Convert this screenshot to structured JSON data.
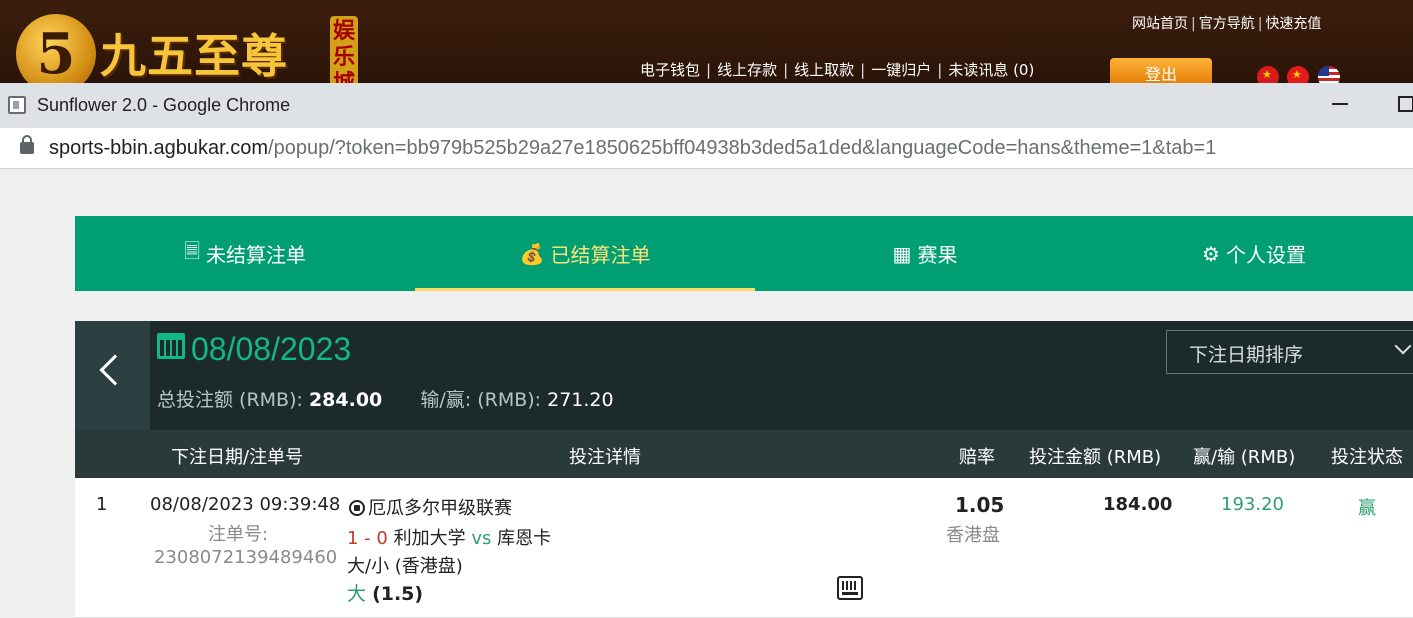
{
  "site": {
    "logo_numeral": "5",
    "logo_text": "九五至尊",
    "logo_badge": "娱乐城",
    "top_links": [
      "网站首页",
      "官方导航",
      "快速充值"
    ],
    "main_links": [
      "电子钱包",
      "线上存款",
      "线上取款",
      "一键归户",
      "未读讯息 (0)"
    ],
    "login_label": "登出"
  },
  "browser": {
    "window_title": "Sunflower 2.0 - Google Chrome",
    "url_host": "sports-bbin.agbukar.com",
    "url_path": "/popup/?token=bb979b525b29a27e1850625bff04938b3ded5a1ded&languageCode=hans&theme=1&tab=1"
  },
  "tabs": [
    {
      "label": "未结算注单",
      "icon": "receipt-icon",
      "active": false
    },
    {
      "label": "已结算注单",
      "icon": "settled-icon",
      "active": true
    },
    {
      "label": "赛果",
      "icon": "scoreboard-icon",
      "active": false
    },
    {
      "label": "个人设置",
      "icon": "gear-icon",
      "active": false
    }
  ],
  "summary": {
    "date": "08/08/2023",
    "total_label": "总投注额 (RMB):",
    "total_value": "284.00",
    "winloss_label": "输/赢: (RMB):",
    "winloss_value": "271.20",
    "sort_label": "下注日期排序"
  },
  "table": {
    "headers": [
      "下注日期/注单号",
      "投注详情",
      "赔率",
      "投注金额 (RMB)",
      "赢/输 (RMB)",
      "投注状态"
    ],
    "rows": [
      {
        "index": "1",
        "datetime": "08/08/2023 09:39:48",
        "ticket_label": "注单号:",
        "ticket_no": "2308072139489460",
        "league": "厄瓜多尔甲级联赛",
        "score": "1 - 0",
        "home": "利加大学",
        "vs": "vs",
        "away": "库恩卡",
        "market": "大/小 (香港盘)",
        "selection": "大",
        "line": "(1.5)",
        "odds": "1.05",
        "odds_type": "香港盘",
        "stake": "184.00",
        "winloss": "193.20",
        "status": "赢"
      }
    ]
  },
  "colors": {
    "accent_green": "#009f73",
    "active_tab_text": "#ffe27a",
    "panel_dark": "#1d2a2b",
    "win_green": "#2e9e6e",
    "score_red": "#c0392b"
  }
}
